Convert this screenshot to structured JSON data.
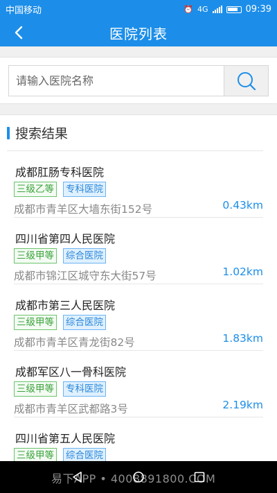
{
  "status_bar": {
    "carrier": "中国移动",
    "network": "4G",
    "time": "09:39"
  },
  "header": {
    "title": "医院列表",
    "back_icon": "chevron-left-icon"
  },
  "search": {
    "placeholder": "请输入医院名称",
    "value": "",
    "button_icon": "search-icon"
  },
  "results": {
    "heading": "搜索结果",
    "items": [
      {
        "name": "成都肛肠专科医院",
        "level": "三级乙等",
        "type": "专科医院",
        "address": "成都市青羊区大墙东街152号",
        "distance": "0.43km"
      },
      {
        "name": "四川省第四人民医院",
        "level": "三级甲等",
        "type": "综合医院",
        "address": "成都市锦江区城守东大街57号",
        "distance": "1.02km"
      },
      {
        "name": "成都市第三人民医院",
        "level": "三级甲等",
        "type": "综合医院",
        "address": "成都市青羊区青龙街82号",
        "distance": "1.83km"
      },
      {
        "name": "成都军区八一骨科医院",
        "level": "三级甲等",
        "type": "专科医院",
        "address": "成都市青羊区武都路3号",
        "distance": "2.19km"
      },
      {
        "name": "四川省第五人民医院",
        "level": "三级甲等",
        "type": "综合医院",
        "address": "",
        "distance": ""
      }
    ]
  },
  "watermark": "易下APP • 4008891800.COM",
  "colors": {
    "primary": "#1c8ee9",
    "level_tag": "#3aa23a",
    "type_tag": "#2a87d8"
  }
}
